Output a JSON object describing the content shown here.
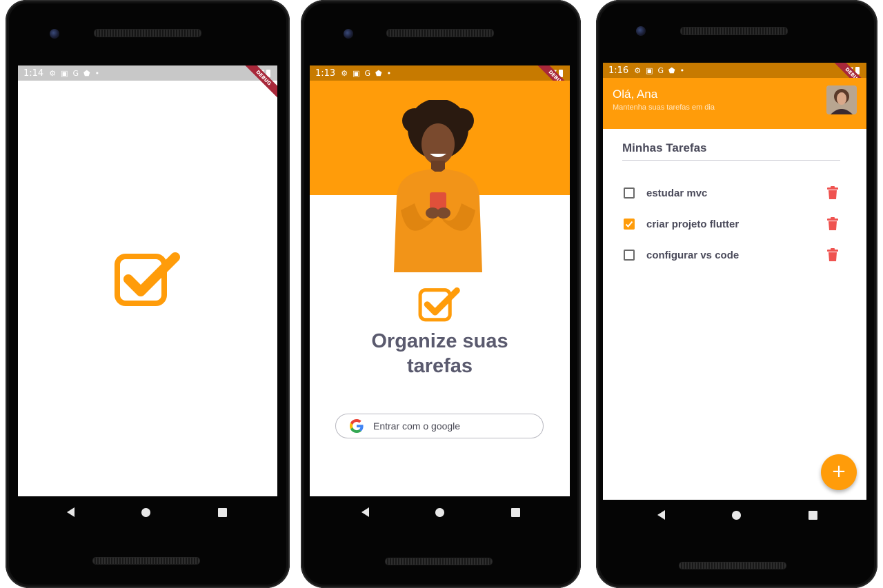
{
  "phone1": {
    "status": {
      "time": "1:14",
      "debug_label": "DEBUG"
    }
  },
  "phone2": {
    "status": {
      "time": "1:13",
      "debug_label": "DEBUG"
    },
    "title_line1": "Organize suas",
    "title_line2": "tarefas",
    "google_button_label": "Entrar com o google"
  },
  "phone3": {
    "status": {
      "time": "1:16",
      "debug_label": "DEBUG"
    },
    "header": {
      "greeting": "Olá, Ana",
      "subtitle": "Mantenha suas tarefas em dia"
    },
    "section_title": "Minhas Tarefas",
    "tasks": [
      {
        "label": "estudar mvc",
        "checked": false
      },
      {
        "label": "criar projeto flutter",
        "checked": true
      },
      {
        "label": "configurar vs code",
        "checked": false
      }
    ],
    "fab_label": "+"
  },
  "colors": {
    "accent": "#ff9c0a",
    "delete": "#ef5350",
    "text": "#5a5a6e"
  }
}
